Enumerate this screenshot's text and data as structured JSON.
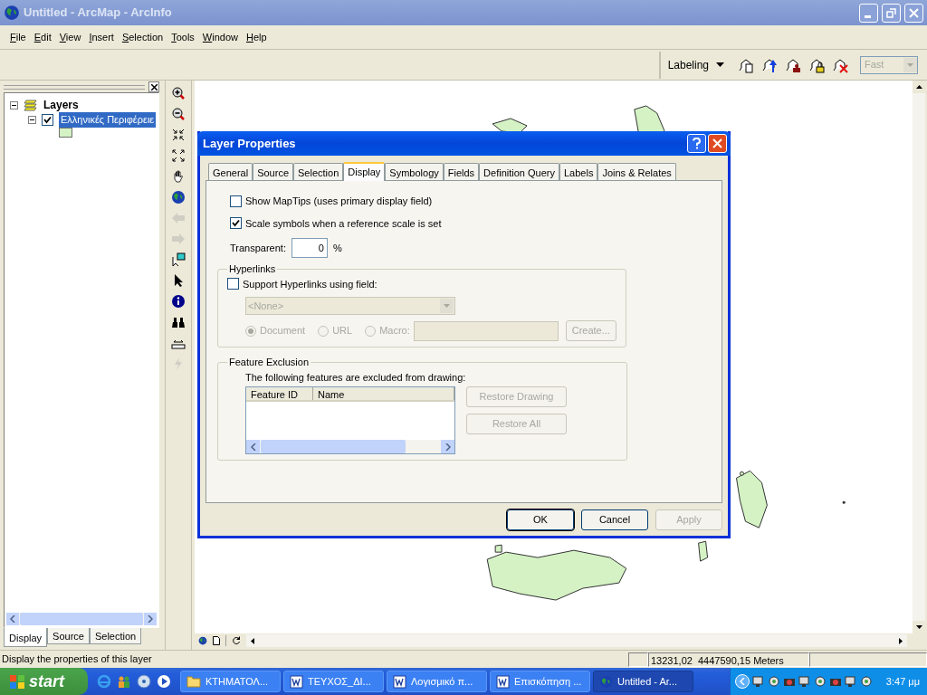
{
  "window": {
    "title": "Untitled - ArcMap - ArcInfo"
  },
  "menu": [
    {
      "label": "File"
    },
    {
      "label": "Edit"
    },
    {
      "label": "View"
    },
    {
      "label": "Insert"
    },
    {
      "label": "Selection"
    },
    {
      "label": "Tools"
    },
    {
      "label": "Window"
    },
    {
      "label": "Help"
    }
  ],
  "labeling_toolbar": {
    "label": "Labeling",
    "speed": {
      "value": "Fast",
      "disabled": true
    }
  },
  "toc": {
    "root": {
      "label": "Layers",
      "expanded": true,
      "children": [
        {
          "label": "Ελληνικές Περιφέρειε",
          "checked": true,
          "selected": true,
          "expanded": true
        }
      ]
    },
    "tabs": [
      {
        "label": "Display",
        "selected": true
      },
      {
        "label": "Source",
        "selected": false
      },
      {
        "label": "Selection",
        "selected": false
      }
    ]
  },
  "tools": [
    {
      "kind": "zoom-in",
      "disabled": false
    },
    {
      "kind": "zoom-out",
      "disabled": false
    },
    {
      "kind": "fixed-in",
      "disabled": false
    },
    {
      "kind": "fixed-out",
      "disabled": false
    },
    {
      "kind": "pan",
      "disabled": false
    },
    {
      "kind": "full-extent",
      "disabled": false
    },
    {
      "kind": "back",
      "disabled": true
    },
    {
      "kind": "forward",
      "disabled": true
    },
    {
      "kind": "select-features",
      "disabled": false
    },
    {
      "kind": "select-elements",
      "disabled": false
    },
    {
      "kind": "identify",
      "disabled": false
    },
    {
      "kind": "find",
      "disabled": false
    },
    {
      "kind": "measure",
      "disabled": false
    },
    {
      "kind": "hyperlink",
      "disabled": true
    }
  ],
  "dialog": {
    "title": "Layer Properties",
    "tabs": [
      {
        "label": "General",
        "selected": false
      },
      {
        "label": "Source",
        "selected": false
      },
      {
        "label": "Selection",
        "selected": false
      },
      {
        "label": "Display",
        "selected": true
      },
      {
        "label": "Symbology",
        "selected": false
      },
      {
        "label": "Fields",
        "selected": false
      },
      {
        "label": "Definition Query",
        "selected": false
      },
      {
        "label": "Labels",
        "selected": false
      },
      {
        "label": "Joins & Relates",
        "selected": false
      }
    ],
    "options": [
      {
        "label": "Show MapTips (uses primary display field)",
        "checked": false
      },
      {
        "label": "Scale symbols when a reference scale is set",
        "checked": true
      }
    ],
    "transparent": {
      "label": "Transparent:",
      "value": "0",
      "unit": "%"
    },
    "hyperlinks": {
      "title": "Hyperlinks",
      "support": {
        "label": "Support Hyperlinks using field:",
        "checked": false
      },
      "field": {
        "value": "<None>",
        "disabled": true
      },
      "radios": [
        {
          "label": "Document",
          "selected": true,
          "disabled": true
        },
        {
          "label": "URL",
          "selected": false,
          "disabled": true
        },
        {
          "label": "Macro:",
          "selected": false,
          "disabled": true
        }
      ],
      "create": {
        "label": "Create...",
        "disabled": true
      }
    },
    "exclusion": {
      "title": "Feature Exclusion",
      "caption": "The following features are excluded from drawing:",
      "columns": [
        "Feature ID",
        "Name"
      ],
      "buttons": [
        {
          "label": "Restore Drawing",
          "disabled": true
        },
        {
          "label": "Restore All",
          "disabled": true
        }
      ]
    },
    "buttons": [
      {
        "label": "OK",
        "disabled": false,
        "default": true
      },
      {
        "label": "Cancel",
        "disabled": false,
        "default": false
      },
      {
        "label": "Apply",
        "disabled": true,
        "default": false
      }
    ]
  },
  "status_bar": {
    "message": "Display the properties of this layer",
    "coordinates": "13231,02  4447590,15 Meters"
  },
  "taskbar": {
    "start": "start",
    "tasks": [
      {
        "kind": "folder",
        "label": "ΚΤΗΜΑΤΟΛ...",
        "selected": false
      },
      {
        "kind": "word",
        "label": "ΤΕΥΧΟΣ_ΔΙ...",
        "selected": false
      },
      {
        "kind": "word",
        "label": "Λογισμικό π...",
        "selected": false
      },
      {
        "kind": "word",
        "label": "Επισκόπηση ...",
        "selected": false
      },
      {
        "kind": "arcmap",
        "label": "Untitled - Ar...",
        "selected": true
      }
    ],
    "clock": "3:47 μμ"
  }
}
